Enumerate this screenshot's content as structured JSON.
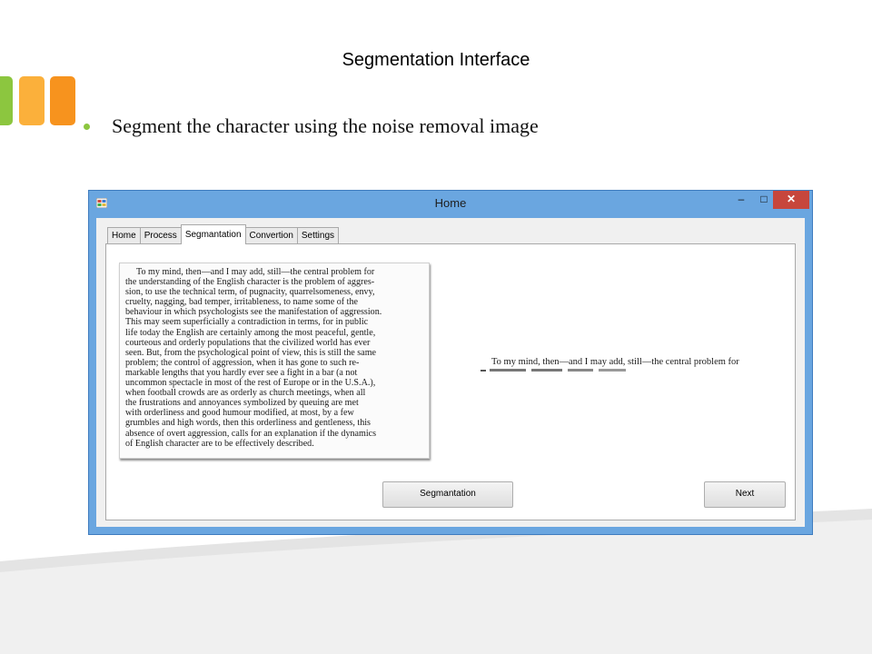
{
  "slide": {
    "title": "Segmentation Interface",
    "bullet": "Segment the character using the noise removal image",
    "colors": {
      "accent_green": "#8cc63f",
      "accent_yellow": "#fbb03b",
      "accent_orange": "#f7931e"
    }
  },
  "window": {
    "title": "Home",
    "controls": {
      "minimize": "–",
      "maximize": "□",
      "close": "✕"
    },
    "tabs": [
      {
        "label": "Home",
        "active": false
      },
      {
        "label": "Process",
        "active": false
      },
      {
        "label": "Segmantation",
        "active": true
      },
      {
        "label": "Convertion",
        "active": false
      },
      {
        "label": "Settings",
        "active": false
      }
    ],
    "document_lines": [
      "To my mind, then—and I may add, still—the central problem for",
      "the understanding of the English character is the problem of aggres-",
      "sion, to use the technical term, of pugnacity, quarrelsomeness, envy,",
      "cruelty, nagging, bad temper, irritableness, to name some of the",
      "behaviour in which psychologists see the manifestation of aggression.",
      "This may seem superficially a contradiction in terms, for in public",
      "life today the English are certainly among the most peaceful, gentle,",
      "courteous and orderly populations that the civilized world has ever",
      "seen. But, from the psychological point of view, this is still the same",
      "problem; the control of aggression, when it has gone to such re-",
      "markable lengths that you hardly ever see a fight in a bar (a not",
      "uncommon spectacle in most of the rest of Europe or in the U.S.A.),",
      "when football crowds are as orderly as church meetings, when all",
      "the frustrations and annoyances symbolized by queuing are met",
      "with orderliness and good humour modified, at most, by a few",
      "grumbles and high words, then this orderliness and gentleness, this",
      "absence of overt aggression, calls for an explanation if the dynamics",
      "of English character are to be effectively described."
    ],
    "segmented_line": "To my mind, then—and I may add, still—the central problem for",
    "buttons": {
      "segmentation": "Segmantation",
      "next": "Next"
    }
  }
}
